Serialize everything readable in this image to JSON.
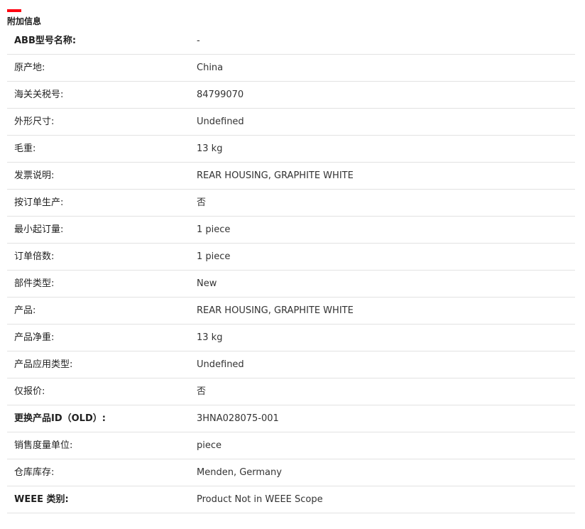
{
  "section": {
    "title": "附加信息",
    "accent_color": "#ff000f"
  },
  "rows": [
    {
      "label": "ABB型号名称:",
      "value": "-"
    },
    {
      "label": "原产地:",
      "value": "China"
    },
    {
      "label": "海关关税号:",
      "value": "84799070"
    },
    {
      "label": "外形尺寸:",
      "value": "Undefined"
    },
    {
      "label": "毛重:",
      "value": "13 kg"
    },
    {
      "label": "发票说明:",
      "value": "REAR HOUSING, GRAPHITE WHITE"
    },
    {
      "label": "按订单生产:",
      "value": "否"
    },
    {
      "label": "最小起订量:",
      "value": "1 piece"
    },
    {
      "label": "订单倍数:",
      "value": "1 piece"
    },
    {
      "label": "部件类型:",
      "value": "New"
    },
    {
      "label": "产品:",
      "value": "REAR HOUSING, GRAPHITE WHITE"
    },
    {
      "label": "产品净重:",
      "value": "13 kg"
    },
    {
      "label": "产品应用类型:",
      "value": "Undefined"
    },
    {
      "label": "仅报价:",
      "value": "否"
    },
    {
      "label": "更换产品ID（OLD）:",
      "value": "3HNA028075-001"
    },
    {
      "label": "销售度量单位:",
      "value": "piece"
    },
    {
      "label": "仓库库存:",
      "value": "Menden, Germany"
    },
    {
      "label": "WEEE 类别:",
      "value": "Product Not in WEEE Scope"
    }
  ]
}
